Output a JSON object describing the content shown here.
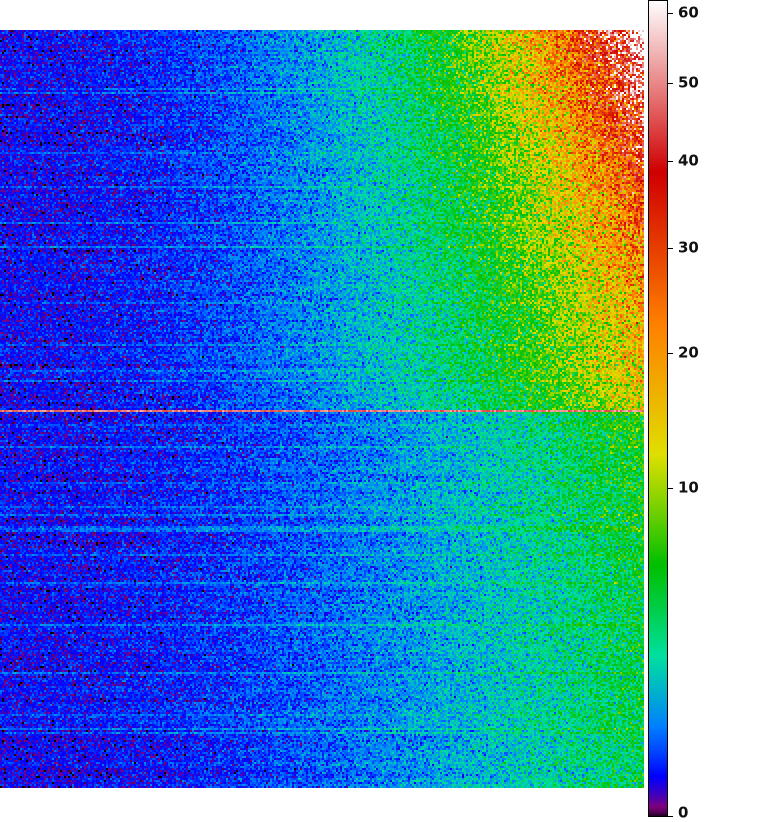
{
  "chart_data": {
    "type": "heatmap",
    "title": "",
    "xlabel": "",
    "ylabel": "",
    "colorbar": {
      "range": [
        0,
        62
      ],
      "ticks": [
        {
          "value": 60,
          "label": "60"
        },
        {
          "value": 50,
          "label": "50"
        },
        {
          "value": 40,
          "label": "40"
        },
        {
          "value": 30,
          "label": "30"
        },
        {
          "value": 20,
          "label": "20"
        },
        {
          "value": 10,
          "label": "10"
        },
        {
          "value": 0,
          "label": "0"
        }
      ],
      "scale": "sqrt",
      "colormap": [
        "#000000",
        "#800080",
        "#0000ff",
        "#0080ff",
        "#00e0a0",
        "#00c000",
        "#e0e000",
        "#ff8000",
        "#d00000",
        "#ffffff"
      ]
    },
    "pattern": "values increase from left (~3) to right (~45); highest in upper-right corner; lower half dimmer; thin bright horizontal line near middle",
    "value_range_observed": [
      0,
      55
    ]
  }
}
